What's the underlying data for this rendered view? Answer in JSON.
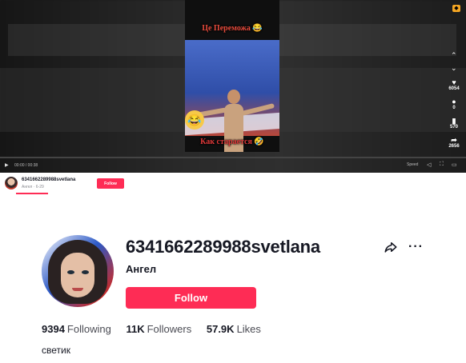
{
  "video": {
    "caption_top": "Це Переможа 😂",
    "caption_bottom": "Как старается 🤣",
    "time": "00:00 / 00:38",
    "speed_label": "Speed",
    "side_actions": [
      {
        "icon": "heart-icon",
        "glyph": "♥",
        "count": "6054"
      },
      {
        "icon": "comment-icon",
        "glyph": "●",
        "count": "0"
      },
      {
        "icon": "bookmark-icon",
        "glyph": "▮",
        "count": "570"
      },
      {
        "icon": "share-icon",
        "glyph": "➦",
        "count": "2656"
      }
    ]
  },
  "mini_bar": {
    "username": "6341662289988svetlana",
    "sub": "Ангел · 6-29",
    "follow_label": "Follow"
  },
  "profile": {
    "username": "6341662289988svetlana",
    "nickname": "Ангел",
    "follow_label": "Follow",
    "more_label": "···",
    "stats": [
      {
        "value": "9394",
        "label": "Following"
      },
      {
        "value": "11K",
        "label": "Followers"
      },
      {
        "value": "57.9K",
        "label": "Likes"
      }
    ],
    "bio": "светик"
  },
  "colors": {
    "accent": "#fe2c55",
    "text": "#161823"
  }
}
